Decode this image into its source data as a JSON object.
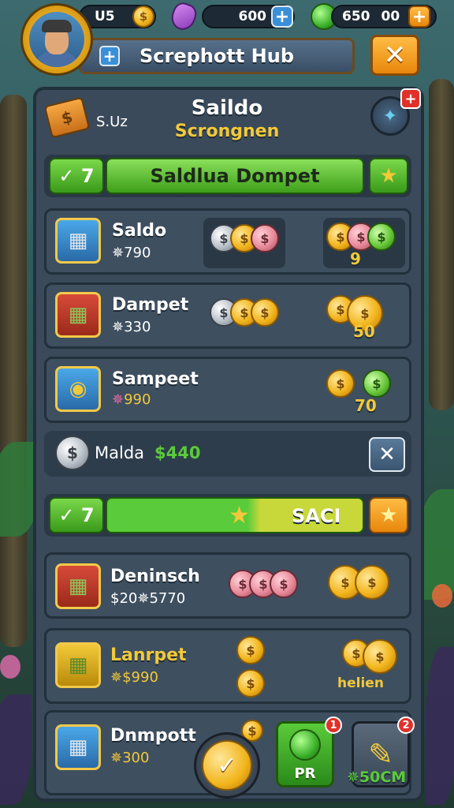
{
  "top_bar": {
    "gold_value": "U5",
    "gold_glyph": "$",
    "gem_value": "600",
    "cash_value": "650",
    "cash_extra": "00",
    "gem_plus": "+",
    "cash_plus": "+"
  },
  "header": {
    "title": "Screphott Hub",
    "title_plus": "+",
    "close_glyph": "✕"
  },
  "panel": {
    "head_title": "Saildo",
    "head_subtitle": "Scrongnen",
    "head_left": "S.Uz",
    "cash_glyph": "$",
    "gem_btn_glyph": "✦",
    "red_plus": "+"
  },
  "progress_rows": [
    {
      "check_label": "✓ 7",
      "bar_label": "Saldlua Dompet",
      "star": "★"
    },
    {
      "check_label": "✓ 7",
      "bar_label": "SACI",
      "star": "★"
    }
  ],
  "items": [
    {
      "name": "Saldo",
      "value": "790",
      "value_prefix": "✵",
      "icon": "cash-stack-blue-icon",
      "reward_num": "9"
    },
    {
      "name": "Dampet",
      "value": "330",
      "value_prefix": "✵",
      "icon": "cash-stack-red-icon",
      "reward_num": "50"
    },
    {
      "name": "Sampeet",
      "value": "990",
      "value_prefix": "✵",
      "icon": "coins-blue-icon",
      "reward_num": "70"
    }
  ],
  "malda": {
    "name": "Malda",
    "value": "$440",
    "close_glyph": "✕"
  },
  "items2": [
    {
      "name": "Deninsch",
      "value": "$20✵5770",
      "icon": "cash-stack-red-icon"
    },
    {
      "name": "Lanrpet",
      "value": "✵$990",
      "icon": "cash-stack-gold-icon",
      "reward_text": "helien"
    },
    {
      "name": "Dnmpott",
      "value": "✵300",
      "icon": "cash-stack-blue-icon"
    }
  ],
  "bottom": {
    "confirm_glyph": "✓",
    "pr_label": "PR",
    "pr_badge": "1",
    "pencil_badge": "2",
    "pencil_label": "✵50CM"
  },
  "colors": {
    "accent_gold": "#f2c93a",
    "accent_green": "#5acb3a",
    "panel_bg": "#3a4a5a"
  }
}
